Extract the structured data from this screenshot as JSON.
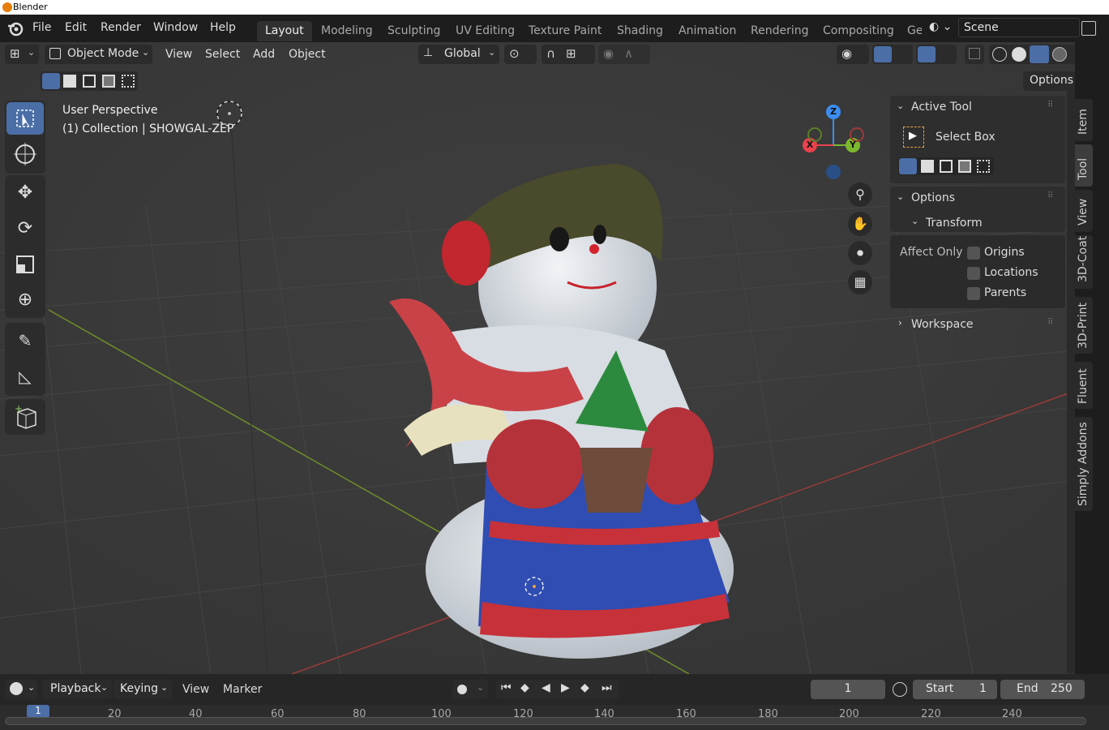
{
  "window": {
    "title": "Blender"
  },
  "menu": [
    "File",
    "Edit",
    "Render",
    "Window",
    "Help"
  ],
  "workspaces": [
    "Layout",
    "Modeling",
    "Sculpting",
    "UV Editing",
    "Texture Paint",
    "Shading",
    "Animation",
    "Rendering",
    "Compositing",
    "Ge"
  ],
  "active_workspace": "Layout",
  "scene": {
    "name": "Scene"
  },
  "viewport_header": {
    "mode": "Object Mode",
    "menus": [
      "View",
      "Select",
      "Add",
      "Object"
    ],
    "transform_orientation": "Global",
    "options_label": "Options"
  },
  "viewport": {
    "perspective_label": "User Perspective",
    "collection_label": "(1) Collection | SHOWGAL-ZEP"
  },
  "gizmo": {
    "x": "X",
    "y": "Y",
    "z": "Z"
  },
  "n_panel": {
    "active_tool_title": "Active Tool",
    "tool_name": "Select Box",
    "options_title": "Options",
    "transform_title": "Transform",
    "affect_only_label": "Affect Only",
    "checkboxes": [
      "Origins",
      "Locations",
      "Parents"
    ],
    "workspace_title": "Workspace"
  },
  "side_tabs": [
    "Item",
    "Tool",
    "View",
    "3D-Coat",
    "3D-Print",
    "Fluent",
    "Simply Addons"
  ],
  "active_side_tab": "Tool",
  "timeline": {
    "menus": [
      "Playback",
      "Keying",
      "View",
      "Marker"
    ],
    "current_frame": "1",
    "start_label": "Start",
    "start_value": "1",
    "end_label": "End",
    "end_value": "250",
    "ruler": [
      "1",
      "20",
      "40",
      "60",
      "80",
      "100",
      "120",
      "140",
      "160",
      "180",
      "200",
      "220",
      "240"
    ]
  },
  "colors": {
    "accent": "#4b6ea6",
    "x_axis": "#e8424d",
    "y_axis": "#7cb82f",
    "z_axis": "#3b8ef0"
  }
}
